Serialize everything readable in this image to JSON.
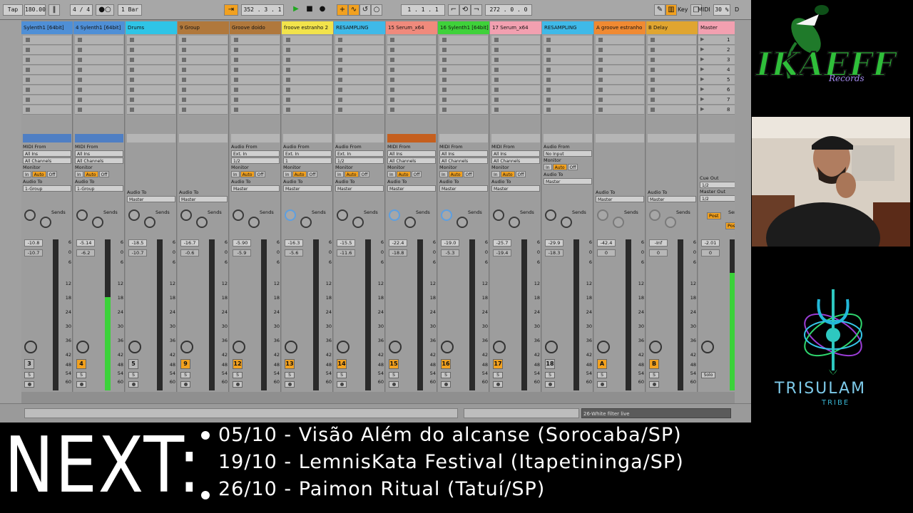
{
  "transport": {
    "tap": "Tap",
    "tempo": "180.00",
    "signature": "4 / 4",
    "quantize": "1 Bar",
    "arrangement_position": "352 . 3 . 1",
    "loop_start": "1 . 1 . 1",
    "loop_length": "272 . 0 . 0",
    "key_label": "Key",
    "midi_label": "MIDI",
    "cpu": "30 %",
    "d_label": "D"
  },
  "tracks": [
    {
      "name": "Sylenth1 [64bit]",
      "color": "#4f8fd6",
      "vol": "-10.8",
      "vol2": "-10.7",
      "num": "3",
      "num_on": false,
      "activity": "on",
      "io": {
        "from_label": "MIDI From",
        "from": "All Ins",
        "channel": "All Channels",
        "to": "1-Group"
      },
      "meter": 0
    },
    {
      "name": "4 Sylenth1 [64bit]",
      "color": "#4f8fd6",
      "vol": "-5.14",
      "vol2": "-6.2",
      "num": "4",
      "num_on": true,
      "activity": "on",
      "io": {
        "from_label": "MIDI From",
        "from": "All Ins",
        "channel": "All Channels",
        "to": "1-Group"
      },
      "meter": 0.62
    },
    {
      "name": "Drums",
      "color": "#2fc4e6",
      "vol": "-18.5",
      "vol2": "-10.7",
      "num": "5",
      "num_on": false,
      "activity": "off",
      "io": null,
      "to": "Master",
      "meter": 0
    },
    {
      "name": "9 Group",
      "color": "#b0783c",
      "vol": "-16.7",
      "vol2": "-0.6",
      "num": "9",
      "num_on": true,
      "activity": "off",
      "io": null,
      "to": "Master",
      "meter": 0
    },
    {
      "name": "Groove doido",
      "color": "#b0783c",
      "vol": "-5.90",
      "vol2": "-5.9",
      "num": "12",
      "num_on": true,
      "activity": "off",
      "io": {
        "from_label": "Audio From",
        "from": "Ext. In",
        "channel": "1/2",
        "to": "Master"
      },
      "meter": 0
    },
    {
      "name": "froove estranho 2",
      "color": "#f2e34b",
      "vol": "-16.3",
      "vol2": "-5.6",
      "num": "13",
      "num_on": true,
      "activity": "off",
      "io": {
        "from_label": "Audio From",
        "from": "Ext. In",
        "channel": "1",
        "to": "Master"
      },
      "meter": 0
    },
    {
      "name": "RESAMPLING",
      "color": "#3fb9e8",
      "vol": "-15.5",
      "vol2": "-11.6",
      "num": "14",
      "num_on": true,
      "activity": "off",
      "io": {
        "from_label": "Audio From",
        "from": "Ext. In",
        "channel": "1/2",
        "to": "Master"
      },
      "meter": 0
    },
    {
      "name": "15 Serum_x64",
      "color": "#f08a7c",
      "vol": "-22.4",
      "vol2": "-18.8",
      "num": "15",
      "num_on": true,
      "activity": "orange",
      "io": {
        "from_label": "MIDI From",
        "from": "All Ins",
        "channel": "All Channels",
        "to": "Master"
      },
      "meter": 0
    },
    {
      "name": "16 Sylenth1 [64bit]",
      "color": "#3fd13a",
      "vol": "-19.0",
      "vol2": "-5.3",
      "num": "16",
      "num_on": true,
      "activity": "off",
      "io": {
        "from_label": "MIDI From",
        "from": "All Ins",
        "channel": "All Channels",
        "to": "Master"
      },
      "meter": 0
    },
    {
      "name": "17 Serum_x64",
      "color": "#f2a0b0",
      "vol": "-25.7",
      "vol2": "-19.4",
      "num": "17",
      "num_on": true,
      "activity": "off",
      "io": {
        "from_label": "MIDI From",
        "from": "All Ins",
        "channel": "All Channels",
        "to": "Master"
      },
      "meter": 0
    },
    {
      "name": "RESAMPLING",
      "color": "#3fb9e8",
      "vol": "-29.9",
      "vol2": "-18.3",
      "num": "18",
      "num_on": false,
      "activity": "off",
      "io": {
        "from_label": "Audio From",
        "from": "No Input",
        "channel": "",
        "to": "Master"
      },
      "meter": 0
    },
    {
      "name": "A groove estranho",
      "color": "#f08a32",
      "vol": "-42.4",
      "vol2": "0",
      "num": "A",
      "num_on": true,
      "activity": "off",
      "io": null,
      "to": "Master",
      "meter": 0
    },
    {
      "name": "B Delay",
      "color": "#e0a530",
      "vol": "-Inf",
      "vol2": "0",
      "num": "B",
      "num_on": true,
      "activity": "off",
      "io": null,
      "to": "Master",
      "meter": 0
    }
  ],
  "master": {
    "name": "Master",
    "color": "#f2a0b0",
    "vol": "-2.01",
    "vol2": "0",
    "cue_out_label": "Cue Out",
    "cue_out": "1/2",
    "master_out_label": "Master Out",
    "master_out": "1/2",
    "sends_label": "Sends",
    "post1": "Post",
    "post2": "Post",
    "solo_label": "Solo",
    "scenes": [
      "1",
      "2",
      "3",
      "4",
      "5",
      "6",
      "7",
      "8"
    ],
    "meter": 0.78
  },
  "labels": {
    "sends": "Sends",
    "monitor": "Monitor",
    "audio_to": "Audio To",
    "mon_in": "In",
    "mon_auto": "Auto",
    "mon_off": "Off",
    "solo_btn": "S",
    "a": "A",
    "b": "B"
  },
  "scale": [
    "6",
    "0",
    "6",
    "12",
    "18",
    "24",
    "30",
    "36",
    "42",
    "48",
    "54",
    "60"
  ],
  "statusbar": {
    "device": "26-White filter live"
  },
  "branding": {
    "ikaeff": "IKAEFF",
    "ikaeff_sub": "Records",
    "trisulam": "TRISULAM",
    "trisulam_sub": "TRIBE"
  },
  "banner": {
    "next": "NEXT:",
    "events": [
      "05/10 - Visão Além do alcanse (Sorocaba/SP)",
      "19/10 - LemnisKata Festival (Itapetininga/SP)",
      "26/10 - Paimon Ritual (Tatuí/SP)"
    ]
  }
}
